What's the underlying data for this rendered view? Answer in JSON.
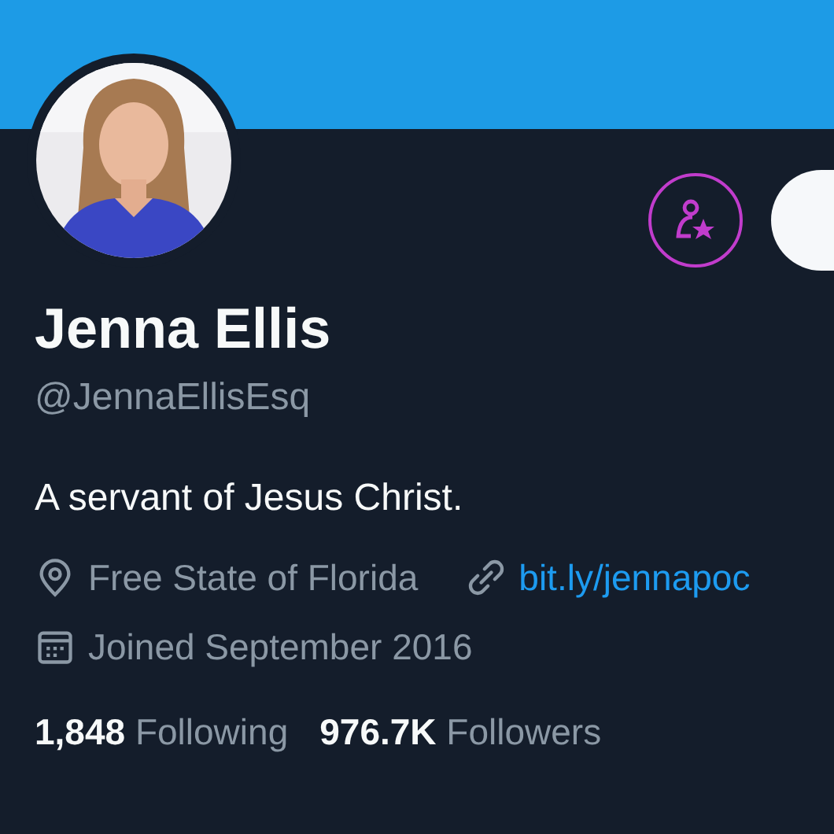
{
  "profile": {
    "name": "Jenna Ellis",
    "handle": "@JennaEllisEsq",
    "bio": "A servant of Jesus Christ.",
    "location": "Free State of Florida",
    "link": "bit.ly/jennapoc",
    "joined": "Joined September 2016"
  },
  "stats": [
    {
      "count": "1,848",
      "label": "Following"
    },
    {
      "count": "976.7K",
      "label": "Followers"
    }
  ]
}
